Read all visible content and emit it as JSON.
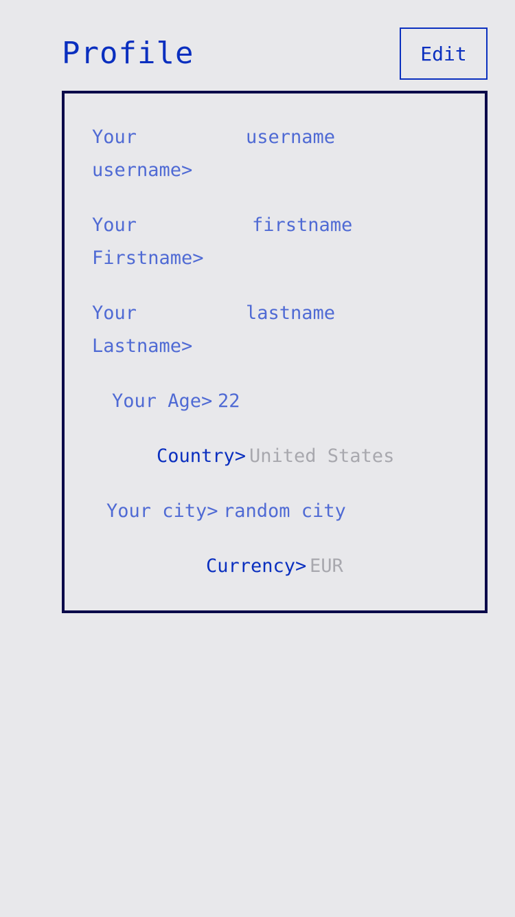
{
  "header": {
    "title": "Profile",
    "edit_label": "Edit"
  },
  "profile": {
    "username": {
      "label_part1": "Your",
      "label_part2": "username>",
      "value": "username"
    },
    "firstname": {
      "label_part1": "Your",
      "label_part2": "Firstname>",
      "value": "firstname"
    },
    "lastname": {
      "label_part1": "Your",
      "label_part2": "Lastname>",
      "value": "lastname"
    },
    "age": {
      "label": "Your Age>",
      "value": "22"
    },
    "country": {
      "label": "Country>",
      "value": "United States"
    },
    "city": {
      "label": "Your city>",
      "value": "random city"
    },
    "currency": {
      "label": "Currency>",
      "value": "EUR"
    }
  }
}
